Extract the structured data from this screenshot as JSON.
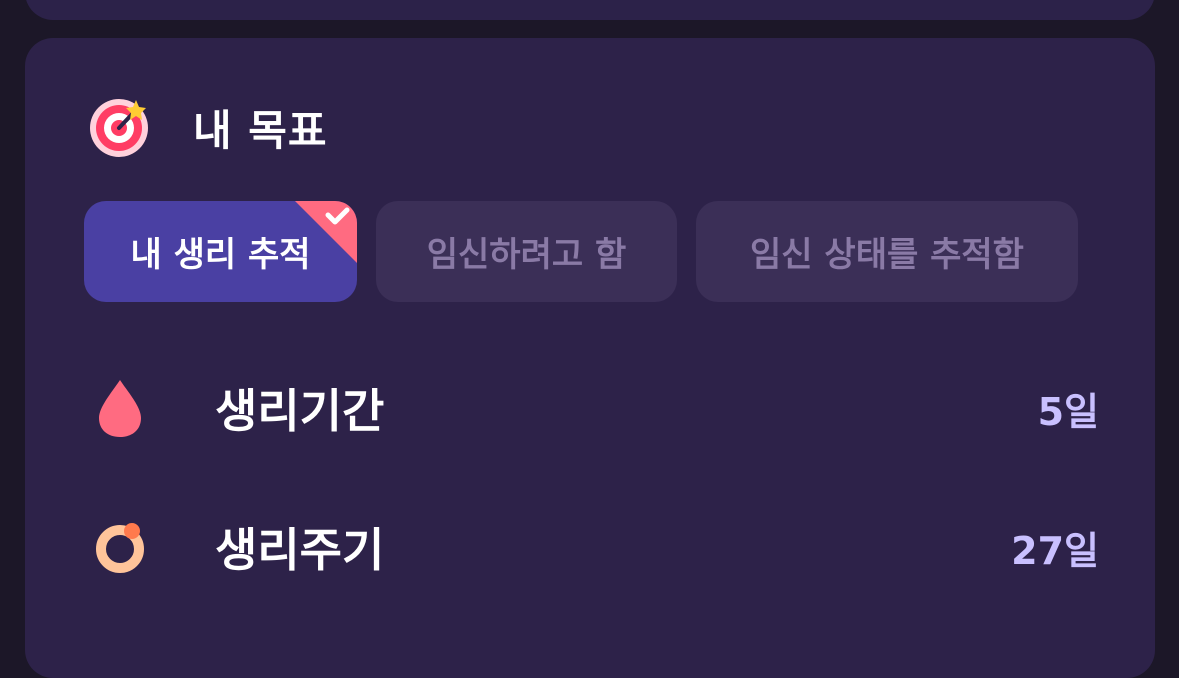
{
  "goal": {
    "title": "내 목표",
    "options": [
      {
        "label": "내 생리 추적",
        "selected": true
      },
      {
        "label": "임신하려고 함",
        "selected": false
      },
      {
        "label": "임신 상태를 추적함",
        "selected": false
      }
    ]
  },
  "settings": [
    {
      "label": "생리기간",
      "value": "5일",
      "icon": "drop-icon"
    },
    {
      "label": "생리주기",
      "value": "27일",
      "icon": "cycle-ring-icon"
    }
  ],
  "colors": {
    "background": "#1c1728",
    "card": "#2d2249",
    "chip_active": "#4a40a3",
    "chip_inactive": "#3b2f57",
    "accent_pink": "#ff6b81",
    "value_text": "#c9c0ff"
  }
}
